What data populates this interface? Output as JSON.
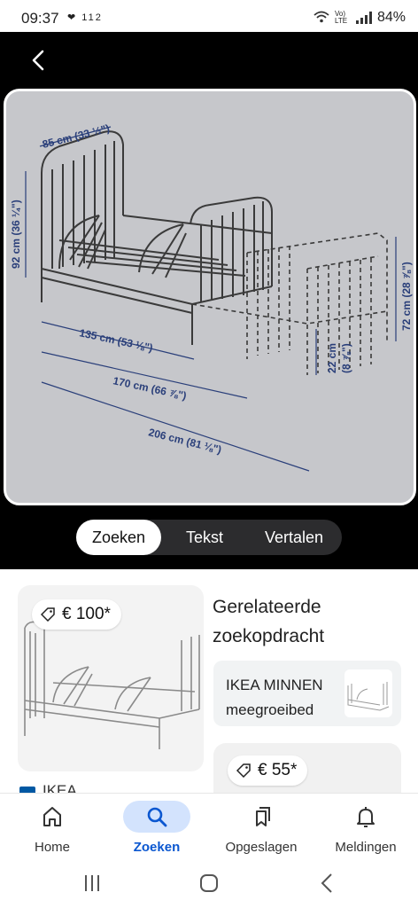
{
  "status_bar": {
    "time": "09:37",
    "notif_icons": "❤ 112",
    "network": "Vo) LTE",
    "battery": "84%"
  },
  "image": {
    "dimensions": {
      "width_top": "85 cm (33 ½\")",
      "height_left": "92 cm (36 ¼\")",
      "length_135": "135 cm (53 ⅛\")",
      "length_170": "170 cm (66 ⅞\")",
      "length_206": "206 cm (81 ⅛\")",
      "leg_22": "22 cm",
      "leg_22_in": "(8 ⅞\")",
      "height_72": "72 cm (28 ⅞\")"
    }
  },
  "modes": {
    "tabs": [
      "Zoeken",
      "Tekst",
      "Vertalen"
    ],
    "active": "Zoeken"
  },
  "results": {
    "left_price": "€ 100*",
    "source": "IKEA",
    "related_title": "Gerelateerde zoekopdracht",
    "related_query": "IKEA MINNEN meegroeibed",
    "right_price": "€ 55*"
  },
  "bottom_nav": {
    "items": [
      "Home",
      "Zoeken",
      "Opgeslagen",
      "Meldingen"
    ],
    "active": "Zoeken"
  },
  "colors": {
    "accent": "#0b57d0",
    "active_pill": "#d3e3fd",
    "dimension_text": "#2a3f7a"
  }
}
